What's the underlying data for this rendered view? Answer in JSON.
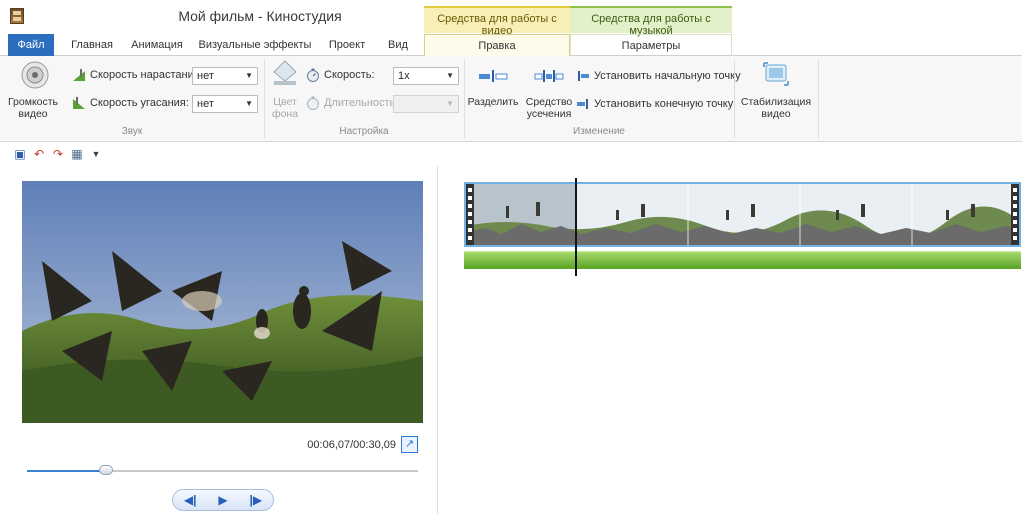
{
  "window": {
    "title": "Мой фильм - Киностудия",
    "context_video": "Средства для работы с видео",
    "context_music": "Средства для работы с музыкой"
  },
  "tabs": [
    {
      "label": "Файл"
    },
    {
      "label": "Главная"
    },
    {
      "label": "Анимация"
    },
    {
      "label": "Визуальные эффекты"
    },
    {
      "label": "Проект"
    },
    {
      "label": "Вид"
    },
    {
      "label": "Правка"
    },
    {
      "label": "Параметры"
    }
  ],
  "ribbon": {
    "volume_label": "Громкость видео",
    "fade_in_label": "Скорость нарастания:",
    "fade_in_value": "нет",
    "fade_out_label": "Скорость угасания:",
    "fade_out_value": "нет",
    "group_sound": "Звук",
    "bg_color_label": "Цвет фона",
    "speed_label": "Скорость:",
    "speed_value": "1x",
    "duration_label": "Длительность:",
    "duration_value": "",
    "group_settings": "Настройка",
    "split_label": "Разделить",
    "trim_label": "Средство усечения",
    "set_start_label": "Установить начальную точку",
    "set_end_label": "Установить конечную точку",
    "group_edit": "Изменение",
    "stabilize_label": "Стабилизация видео"
  },
  "preview": {
    "timecode": "00:06,07/00:30,09",
    "progress_fraction": 0.202
  },
  "colors": {
    "file_tab": "#2a6ebd",
    "context_video": "#f8efb8",
    "context_music": "#e2f1c9",
    "clip_border": "#71b4e3",
    "music_bar": "#59a326"
  }
}
